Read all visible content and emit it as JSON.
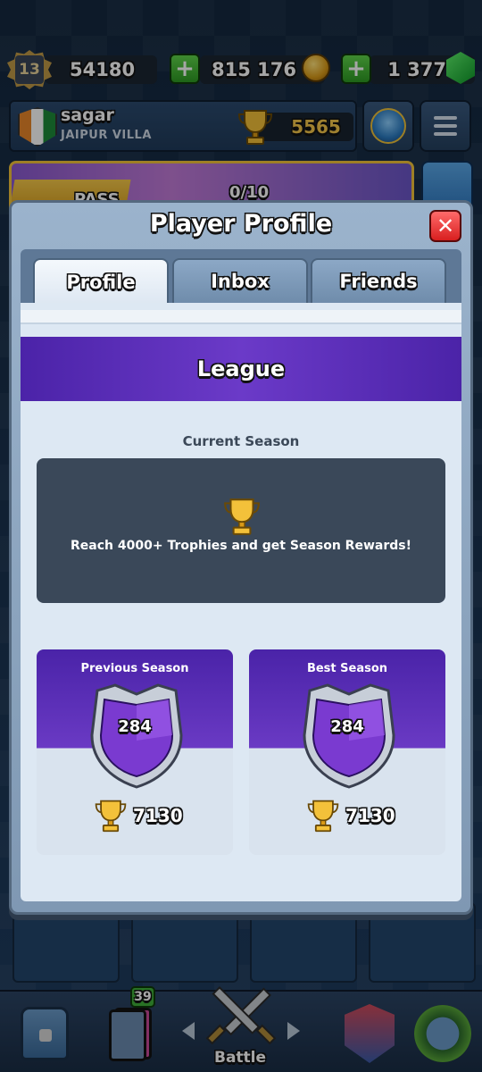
{
  "top_bar": {
    "level": "13",
    "xp": "54180",
    "gold": "815 176",
    "gems": "1 377",
    "plus_label": "+"
  },
  "player": {
    "name": "sagar",
    "clan": "JAIPUR VILLA",
    "trophies": "5565"
  },
  "pass": {
    "label": "PASS",
    "progress": "0/10"
  },
  "bottom_nav": {
    "cards_badge": "39",
    "battle_label": "Battle"
  },
  "modal": {
    "title": "Player Profile",
    "close_label": "✕",
    "tabs": [
      {
        "label": "Profile",
        "active": true
      },
      {
        "label": "Inbox",
        "active": false
      },
      {
        "label": "Friends",
        "active": false
      }
    ],
    "league": {
      "title": "League",
      "current_season_label": "Current Season",
      "current_season_message": "Reach 4000+ Trophies and get Season Rewards!",
      "previous_season": {
        "title": "Previous Season",
        "league_number": "284",
        "trophies": "7130"
      },
      "best_season": {
        "title": "Best Season",
        "league_number": "284",
        "trophies": "7130"
      }
    }
  },
  "icons": {
    "level": "level-badge-icon",
    "gold": "gold-coin-icon",
    "gems": "gem-icon",
    "trophy": "trophy-icon",
    "close": "close-icon",
    "menu": "hamburger-menu-icon"
  },
  "colors": {
    "league_purple": "#4b23a8",
    "trophy_gold": "#f5c74a",
    "close_red": "#d81f1f",
    "plus_green": "#2e9a23"
  }
}
